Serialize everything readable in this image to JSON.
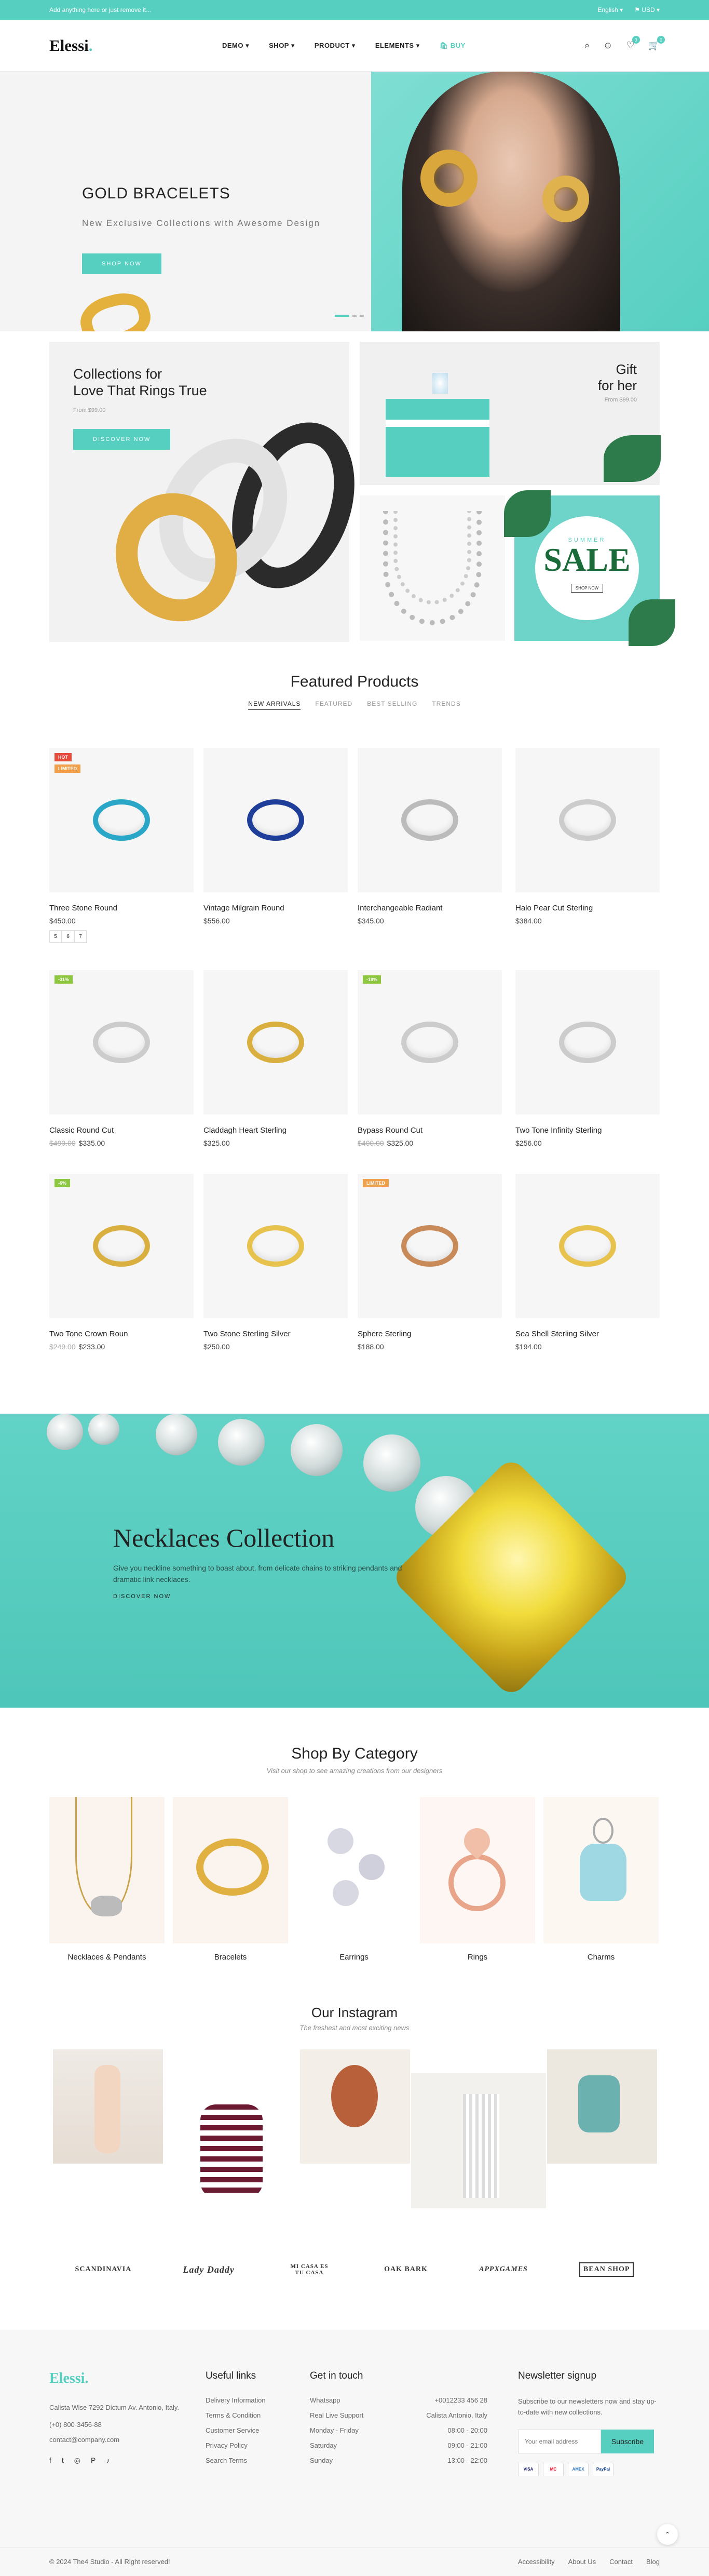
{
  "topbar": {
    "message": "Add anything here or just remove it...",
    "language": "English",
    "currency": "USD"
  },
  "header": {
    "logo": "Elessi",
    "logo_dot": ".",
    "nav": [
      "DEMO",
      "SHOP",
      "PRODUCT",
      "ELEMENTS"
    ],
    "buy": "BUY",
    "wishlist_count": "0",
    "cart_count": "0"
  },
  "hero": {
    "title": "GOLD BRACELETS",
    "subtitle": "New Exclusive Collections with Awesome Design",
    "button": "SHOP NOW"
  },
  "banners": {
    "rings": {
      "title_line1": "Collections for",
      "title_line2": "Love That Rings True",
      "from": "From $99.00",
      "button": "DISCOVER NOW"
    },
    "gift": {
      "title_line1": "Gift",
      "title_line2": "for her",
      "from": "From $99.00"
    },
    "sale": {
      "label": "SUMMER",
      "big": "SALE",
      "small": "SHOP NOW"
    }
  },
  "featured": {
    "title": "Featured Products",
    "tabs": [
      "NEW ARRIVALS",
      "FEATURED",
      "BEST SELLING",
      "TRENDS"
    ],
    "products": [
      {
        "name": "Three Stone Round",
        "price": "$450.00",
        "old": "",
        "tags": [
          "HOT",
          "LIMITED"
        ],
        "sizes": [
          "5",
          "6",
          "7"
        ]
      },
      {
        "name": "Vintage Milgrain Round",
        "price": "$556.00",
        "old": "",
        "tags": []
      },
      {
        "name": "Interchangeable Radiant",
        "price": "$345.00",
        "old": "",
        "tags": []
      },
      {
        "name": "Halo Pear Cut Sterling",
        "price": "$384.00",
        "old": "",
        "tags": []
      },
      {
        "name": "Classic Round Cut",
        "price": "$335.00",
        "old": "$490.00",
        "tags": [
          "-31%"
        ]
      },
      {
        "name": "Claddagh Heart Sterling",
        "price": "$325.00",
        "old": "",
        "tags": []
      },
      {
        "name": "Bypass Round Cut",
        "price": "$325.00",
        "old": "$400.00",
        "tags": [
          "-19%"
        ]
      },
      {
        "name": "Two Tone Infinity Sterling",
        "price": "$256.00",
        "old": "",
        "tags": []
      },
      {
        "name": "Two Tone Crown Roun",
        "price": "$233.00",
        "old": "$249.00",
        "tags": [
          "-6%"
        ]
      },
      {
        "name": "Two Stone Sterling Silver",
        "price": "$250.00",
        "old": "",
        "tags": []
      },
      {
        "name": "Sphere Sterling",
        "price": "$188.00",
        "old": "",
        "tags": [
          "LIMITED"
        ]
      },
      {
        "name": "Sea Shell Sterling Silver",
        "price": "$194.00",
        "old": "",
        "tags": []
      }
    ]
  },
  "necklaces": {
    "title": "Necklaces Collection",
    "text": "Give you neckline something to boast about, from delicate chains to striking pendants and dramatic link necklaces.",
    "link": "DISCOVER NOW"
  },
  "categories": {
    "title": "Shop By Category",
    "subtitle": "Visit our shop to see amazing creations from our designers",
    "items": [
      "Necklaces & Pendants",
      "Bracelets",
      "Earrings",
      "Rings",
      "Charms"
    ]
  },
  "instagram": {
    "title": "Our Instagram",
    "subtitle": "The freshest and most exciting news"
  },
  "brands": [
    "SCANDINAVIA",
    "Lady Daddy",
    "MI CASA ES TU CASA",
    "OAK BARK",
    "APPXGAMES",
    "BEAN SHOP"
  ],
  "footer": {
    "logo": "Elessi",
    "address": "Calista Wise 7292 Dictum Av. Antonio, Italy.",
    "phone": "(+0) 800-3456-88",
    "email": "contact@company.com",
    "useful_title": "Useful links",
    "useful": [
      "Delivery Information",
      "Terms & Condition",
      "Customer Service",
      "Privacy Policy",
      "Search Terms"
    ],
    "touch_title": "Get in touch",
    "touch": [
      {
        "k": "Whatsapp",
        "v": "+0012233 456 28"
      },
      {
        "k": "Real Live Support",
        "v": "Calista Antonio, Italy"
      },
      {
        "k": "Monday - Friday",
        "v": "08:00 - 20:00"
      },
      {
        "k": "Saturday",
        "v": "09:00 - 21:00"
      },
      {
        "k": "Sunday",
        "v": "13:00 - 22:00"
      }
    ],
    "news_title": "Newsletter signup",
    "news_text": "Subscribe to our newsletters now and stay up-to-date with new collections.",
    "news_placeholder": "Your email address",
    "news_button": "Subscribe",
    "payments": [
      "VISA",
      "MC",
      "AMEX",
      "PayPal"
    ],
    "copyright": "© 2024 The4 Studio - All Right reserved!",
    "bottom_links": [
      "Accessibility",
      "About Us",
      "Contact",
      "Blog"
    ]
  }
}
